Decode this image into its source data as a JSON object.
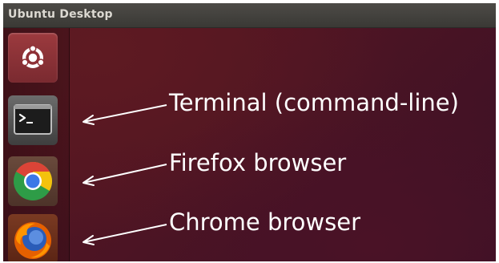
{
  "window": {
    "title": "Ubuntu Desktop"
  },
  "launcher": {
    "items": [
      {
        "icon": "ubuntu-dash-icon"
      },
      {
        "icon": "terminal-icon"
      },
      {
        "icon": "chrome-icon"
      },
      {
        "icon": "firefox-icon"
      }
    ]
  },
  "annotations": [
    {
      "text": "Terminal (command-line)"
    },
    {
      "text": "Firefox browser"
    },
    {
      "text": "Chrome browser"
    }
  ]
}
